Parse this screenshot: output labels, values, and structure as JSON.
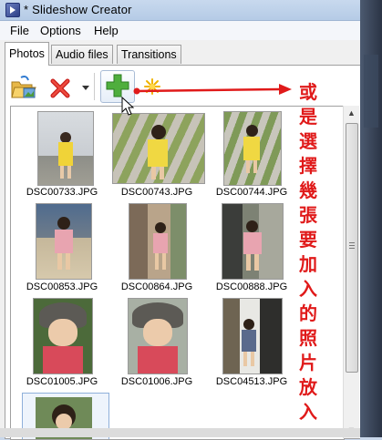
{
  "window": {
    "title": "* Slideshow Creator"
  },
  "menu": {
    "file": "File",
    "options": "Options",
    "help": "Help"
  },
  "tabs": {
    "photos": "Photos",
    "audio": "Audio files",
    "transitions": "Transitions"
  },
  "toolbar": {
    "open_icon": "open-folder-icon",
    "delete_icon": "red-x-icon",
    "add_icon": "green-plus-icon",
    "clear_icon": "sparkle-icon"
  },
  "photos": [
    {
      "name": "DSC00733.JPG"
    },
    {
      "name": "DSC00743.JPG"
    },
    {
      "name": "DSC00744.JPG"
    },
    {
      "name": "DSC00853.JPG"
    },
    {
      "name": "DSC00864.JPG"
    },
    {
      "name": "DSC00888.JPG"
    },
    {
      "name": "DSC01005.JPG"
    },
    {
      "name": "DSC01006.JPG"
    },
    {
      "name": "DSC04513.JPG"
    }
  ],
  "annotation": {
    "chars": [
      "或",
      "是",
      "選",
      "擇",
      "幾",
      "張",
      "要",
      "加",
      "入",
      "的",
      "照",
      "片",
      "放",
      "入"
    ],
    "color": "#e01a1a"
  }
}
